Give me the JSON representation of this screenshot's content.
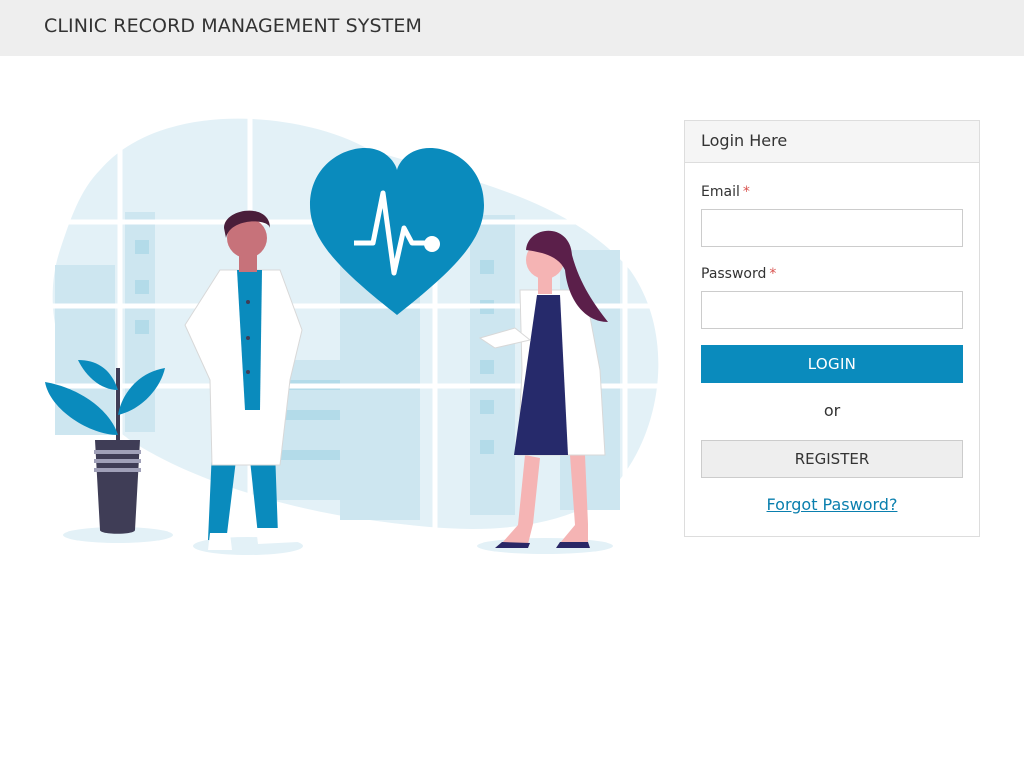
{
  "header": {
    "title": "CLINIC RECORD MANAGEMENT SYSTEM"
  },
  "illustration": {
    "name": "doctors-heart-illustration",
    "accent": "#0a8bbd"
  },
  "login": {
    "heading": "Login Here",
    "email_label": "Email",
    "password_label": "Password",
    "required_mark": "*",
    "email_value": "",
    "password_value": "",
    "login_button": "LOGIN",
    "or_text": "or",
    "register_button": "REGISTER",
    "forgot_link": "Forgot Pasword?"
  },
  "colors": {
    "primary": "#0a8bbd",
    "header_bg": "#eeeeee",
    "required": "#d9534f",
    "link": "#0a7fae"
  }
}
